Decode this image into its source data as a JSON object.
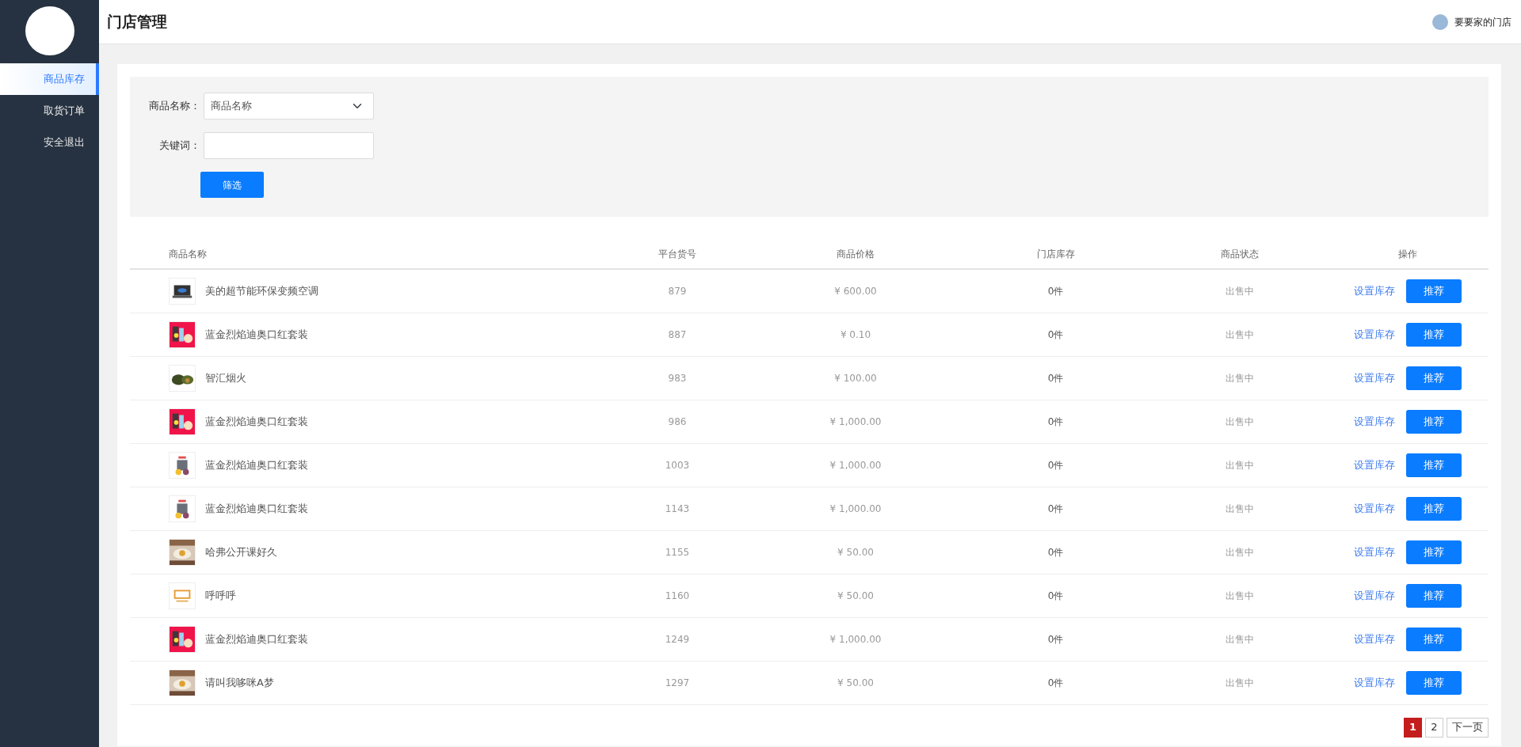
{
  "sidebar": {
    "items": [
      {
        "label": "商品库存",
        "selected": true
      },
      {
        "label": "取货订单",
        "selected": false
      },
      {
        "label": "安全退出",
        "selected": false
      }
    ]
  },
  "header": {
    "title": "门店管理",
    "store_name": "要要家的门店"
  },
  "filter": {
    "fields": [
      {
        "kind": "select",
        "label": "商品名称：",
        "value": "商品名称"
      },
      {
        "kind": "input",
        "label": "关键词："
      }
    ],
    "button": "筛选"
  },
  "table": {
    "columns": [
      "商品名称",
      "平台货号",
      "商品价格",
      "门店库存",
      "商品状态",
      "操作"
    ],
    "rows": [
      {
        "name": "美的超节能环保变频空调",
        "sku": "879",
        "price": "¥ 600.00",
        "stock": "0件",
        "status": "出售中",
        "link": "设置库存",
        "button": "推荐"
      },
      {
        "name": "蓝金烈焰迪奥口红套装",
        "sku": "887",
        "price": "¥ 0.10",
        "stock": "0件",
        "status": "出售中",
        "link": "设置库存",
        "button": "推荐"
      },
      {
        "name": "智汇烟火",
        "sku": "983",
        "price": "¥ 100.00",
        "stock": "0件",
        "status": "出售中",
        "link": "设置库存",
        "button": "推荐"
      },
      {
        "name": "蓝金烈焰迪奥口红套装",
        "sku": "986",
        "price": "¥ 1,000.00",
        "stock": "0件",
        "status": "出售中",
        "link": "设置库存",
        "button": "推荐"
      },
      {
        "name": "蓝金烈焰迪奥口红套装",
        "sku": "1003",
        "price": "¥ 1,000.00",
        "stock": "0件",
        "status": "出售中",
        "link": "设置库存",
        "button": "推荐"
      },
      {
        "name": "蓝金烈焰迪奥口红套装",
        "sku": "1143",
        "price": "¥ 1,000.00",
        "stock": "0件",
        "status": "出售中",
        "link": "设置库存",
        "button": "推荐"
      },
      {
        "name": "哈弗公开课好久",
        "sku": "1155",
        "price": "¥ 50.00",
        "stock": "0件",
        "status": "出售中",
        "link": "设置库存",
        "button": "推荐"
      },
      {
        "name": "呼呼呼",
        "sku": "1160",
        "price": "¥ 50.00",
        "stock": "0件",
        "status": "出售中",
        "link": "设置库存",
        "button": "推荐"
      },
      {
        "name": "蓝金烈焰迪奥口红套装",
        "sku": "1249",
        "price": "¥ 1,000.00",
        "stock": "0件",
        "status": "出售中",
        "link": "设置库存",
        "button": "推荐"
      },
      {
        "name": "请叫我哆咪A梦",
        "sku": "1297",
        "price": "¥ 50.00",
        "stock": "0件",
        "status": "出售中",
        "link": "设置库存",
        "button": "推荐"
      }
    ]
  },
  "pagination": {
    "pages": [
      {
        "label": "1",
        "selected": true
      },
      {
        "label": "2",
        "selected": false
      }
    ],
    "next": "下一页"
  }
}
